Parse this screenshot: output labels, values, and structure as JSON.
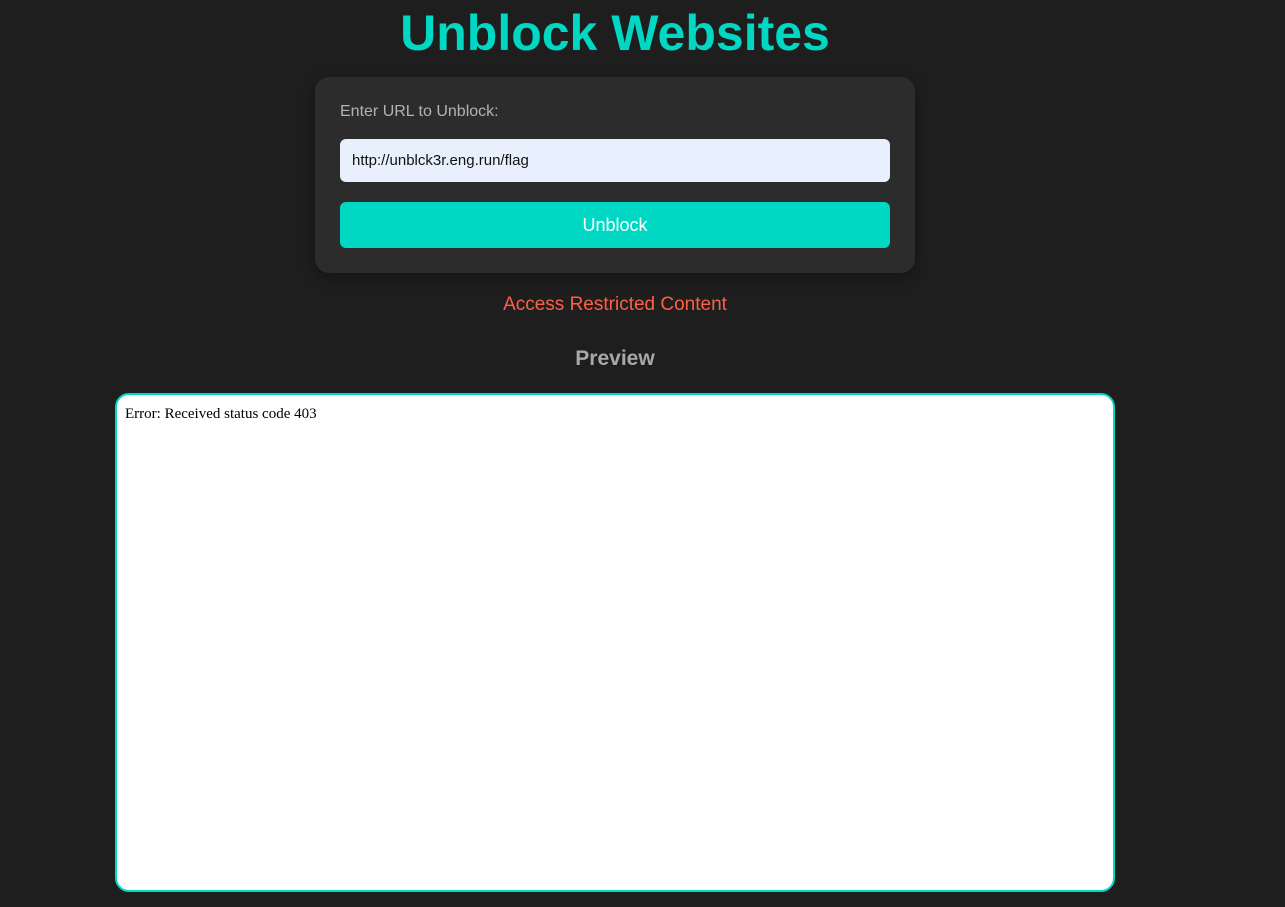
{
  "page": {
    "title": "Unblock Websites"
  },
  "form": {
    "label": "Enter URL to Unblock:",
    "url_value": "http://unblck3r.eng.run/flag",
    "button_label": "Unblock"
  },
  "status_message": "Access Restricted Content",
  "preview": {
    "heading": "Preview",
    "content": "Error: Received status code 403"
  },
  "colors": {
    "accent": "#00d8c4",
    "error": "#ff5f45",
    "background": "#1e1e1e",
    "card": "#2c2c2c",
    "input_background": "#e8f0fe"
  }
}
